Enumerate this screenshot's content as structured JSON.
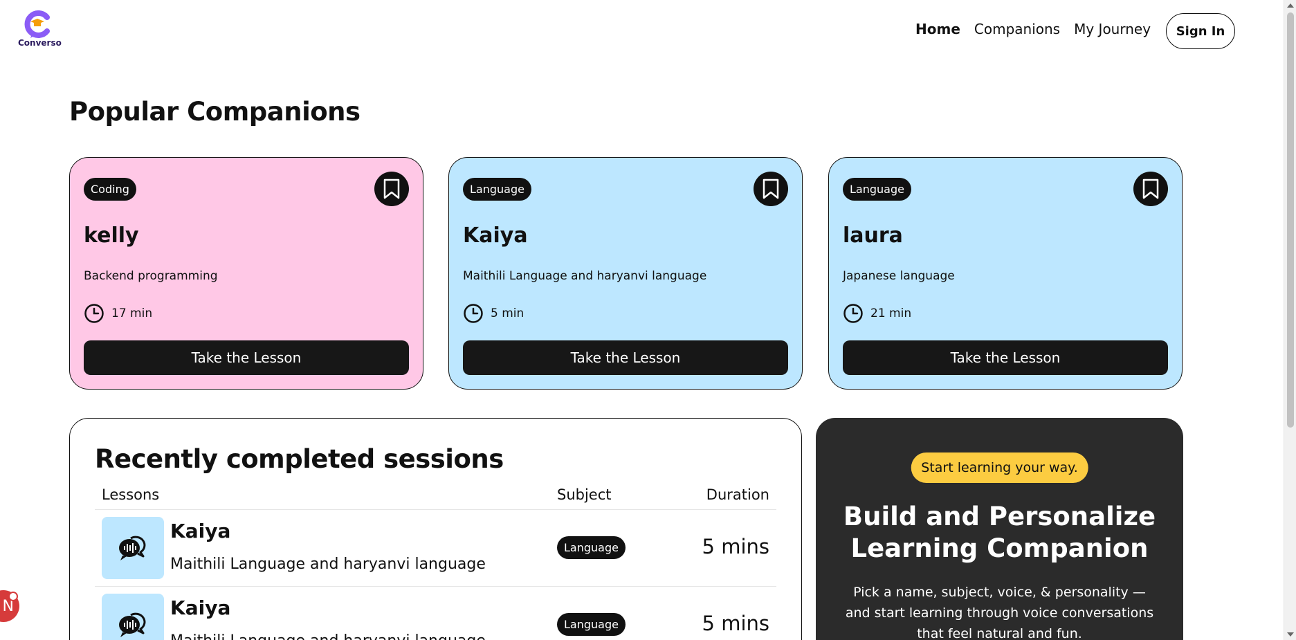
{
  "brand": {
    "name": "Converso"
  },
  "nav": {
    "links": [
      "Home",
      "Companions",
      "My Journey"
    ],
    "sign_in": "Sign In"
  },
  "popular": {
    "title": "Popular Companions",
    "cards": [
      {
        "subject": "Coding",
        "name": "kelly",
        "topic": "Backend programming",
        "duration": "17 min",
        "cta": "Take the Lesson",
        "color": "#ffc8e6"
      },
      {
        "subject": "Language",
        "name": "Kaiya",
        "topic": "Maithili Language and haryanvi language",
        "duration": "5 min",
        "cta": "Take the Lesson",
        "color": "#bde7ff"
      },
      {
        "subject": "Language",
        "name": "laura",
        "topic": "Japanese language",
        "duration": "21 min",
        "cta": "Take the Lesson",
        "color": "#bde7ff"
      }
    ]
  },
  "recent": {
    "title": "Recently completed sessions",
    "headers": {
      "lessons": "Lessons",
      "subject": "Subject",
      "duration": "Duration"
    },
    "rows": [
      {
        "name": "Kaiya",
        "topic": "Maithili Language and haryanvi language",
        "subject": "Language",
        "duration": "5 mins"
      },
      {
        "name": "Kaiya",
        "topic": "Maithili Language and haryanvi language",
        "subject": "Language",
        "duration": "5 mins"
      }
    ]
  },
  "cta": {
    "pill": "Start learning your way.",
    "title": "Build and Personalize Learning Companion",
    "description": "Pick a name, subject, voice, & personality — and start learning through voice conversations that feel natural and fun."
  },
  "floating": {
    "label": "N"
  },
  "colors": {
    "accent_yellow": "#fccc41",
    "dark": "#2b2b2b",
    "pink": "#ffc8e6",
    "blue": "#bde7ff"
  }
}
